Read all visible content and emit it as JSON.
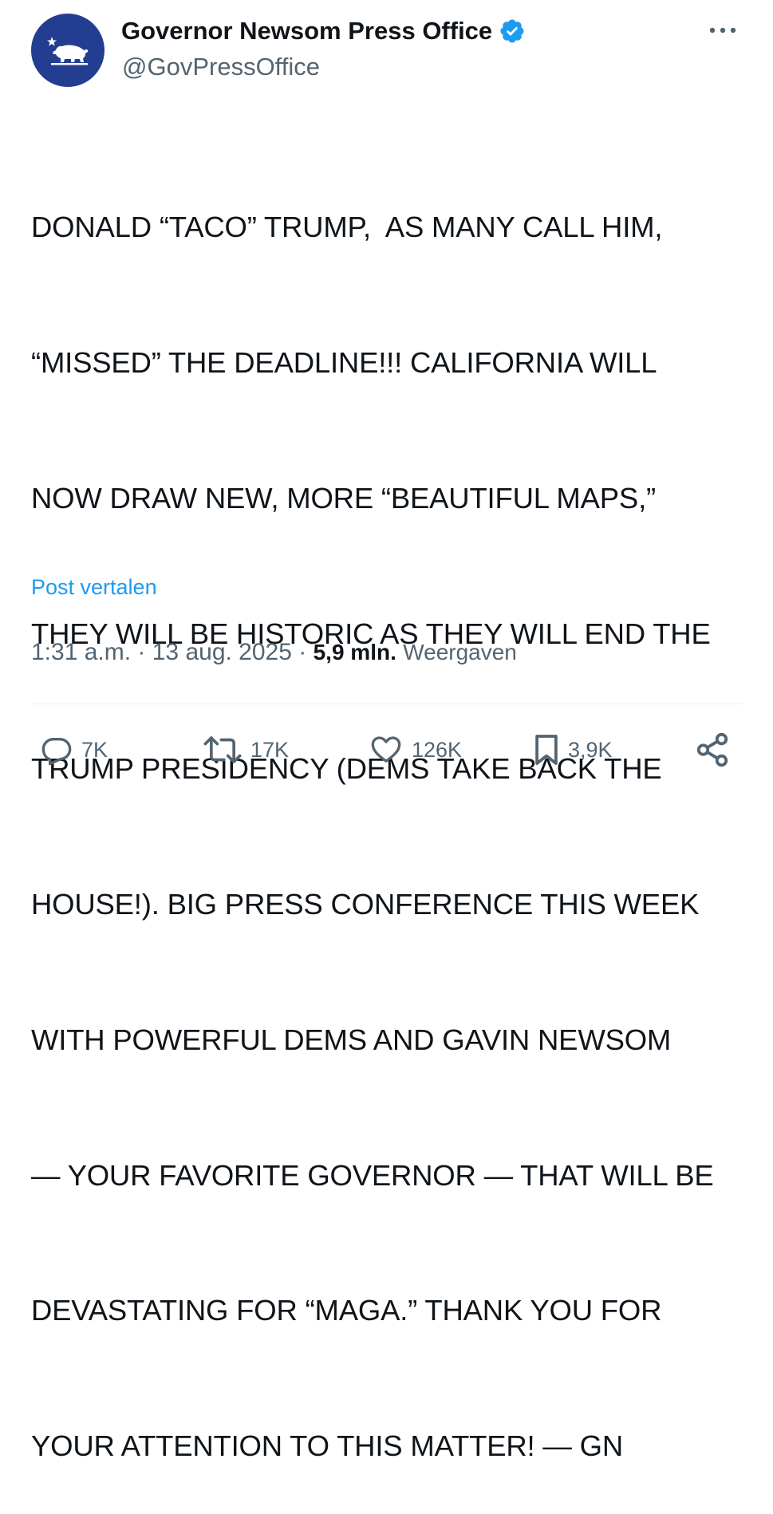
{
  "author": {
    "display_name": "Governor Newsom Press Office",
    "handle": "@GovPressOffice",
    "verified_icon": "verified-badge-icon",
    "avatar_icon": "california-bear-icon",
    "avatar_bg": "#233d91"
  },
  "more_icon": "more-options-icon",
  "tweet": {
    "lines": [
      "DONALD “TACO” TRUMP,  AS MANY CALL HIM,",
      "“MISSED” THE DEADLINE!!! CALIFORNIA WILL",
      "NOW DRAW NEW, MORE “BEAUTIFUL MAPS,”",
      "THEY WILL BE HISTORIC AS THEY WILL END THE",
      "TRUMP PRESIDENCY (DEMS TAKE BACK THE",
      "HOUSE!). BIG PRESS CONFERENCE THIS WEEK",
      "WITH POWERFUL DEMS AND GAVIN NEWSOM",
      "— YOUR FAVORITE GOVERNOR — THAT WILL BE",
      "DEVASTATING FOR “MAGA.” THANK YOU FOR",
      "YOUR ATTENTION TO THIS MATTER! — GN"
    ],
    "translate_label": "Post vertalen"
  },
  "meta": {
    "time": "1:31 a.m.",
    "separator": " · ",
    "date": "13 aug. 2025",
    "views_count": "5,9 mln.",
    "views_label": "Weergaven"
  },
  "actions": {
    "replies": "7K",
    "reposts": "17K",
    "likes": "126K",
    "bookmarks": "3,9K"
  },
  "colors": {
    "text": "#0f1419",
    "secondary": "#536471",
    "link": "#1d9bf0",
    "divider": "#eff3f4"
  }
}
